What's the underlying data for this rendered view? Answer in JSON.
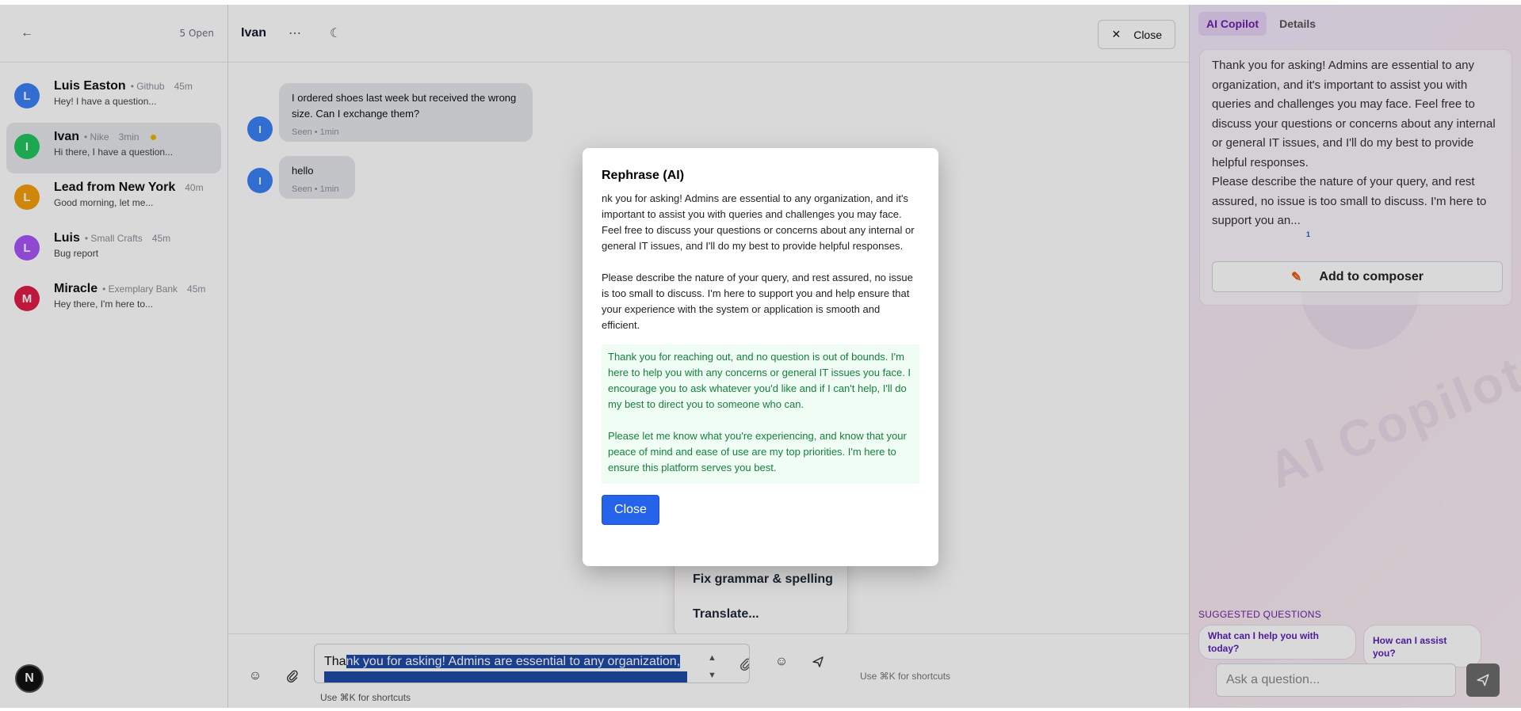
{
  "sidebar": {
    "open_count": "5 Open",
    "conversations": [
      {
        "initial": "L",
        "name": "Luis Easton",
        "org": "• Github",
        "time": "45m",
        "preview": "Hey! I have a question...",
        "color": "#3b82f6"
      },
      {
        "initial": "I",
        "name": "Ivan",
        "org": "• Nike",
        "time": "3min",
        "preview": "Hi there, I have a question...",
        "color": "#22c55e"
      },
      {
        "initial": "L",
        "name": "Lead from New York",
        "org": "",
        "time": "40m",
        "preview": "Good morning, let me...",
        "color": "#f59e0b"
      },
      {
        "initial": "L",
        "name": "Luis",
        "org": "• Small Crafts",
        "time": "45m",
        "preview": "Bug report",
        "color": "#a855f7"
      },
      {
        "initial": "M",
        "name": "Miracle",
        "org": "• Exemplary Bank",
        "time": "45m",
        "preview": "Hey there, I'm here to...",
        "color": "#e11d48"
      }
    ],
    "badge": "N"
  },
  "header": {
    "title": "Ivan",
    "close_label": "Close"
  },
  "messages": [
    {
      "initial": "I",
      "text": "I ordered shoes last week but received the wrong size. Can I exchange them?",
      "meta": "Seen • 1min"
    },
    {
      "initial": "I",
      "text": "hello",
      "meta": "Seen • 1min"
    }
  ],
  "menu": {
    "items": [
      "Fix grammar & spelling",
      "Translate..."
    ]
  },
  "composer": {
    "value_start": "Tha",
    "value_selected": "nk you for asking! Admins are essential to any organization,",
    "hint": "Use ⌘K for shortcuts",
    "hint_right": "Use ⌘K for shortcuts"
  },
  "copilot": {
    "tabs": [
      "AI Copilot",
      "Details"
    ],
    "para1": "Thank you for asking! Admins are essential to any organization, and it's important to assist you with queries and challenges you may face. Feel free to discuss your questions or concerns about any internal or general IT issues, and I'll do my best to provide helpful responses.",
    "para2": "Please describe the nature of your query, and rest assured, no issue is too small to discuss. I'm here to support you an...",
    "footnote": "1",
    "add_label": "Add to composer",
    "watermark": "AI Copilot",
    "suggested_label": "SUGGESTED QUESTIONS",
    "suggestions": [
      "What can I help you with today?",
      "How can I assist you?"
    ],
    "ask_placeholder": "Ask a question..."
  },
  "modal": {
    "title": "Rephrase (AI)",
    "original": "nk you for asking! Admins are essential to any organization, and it's important to assist you with queries and challenges you may face. Feel free to discuss your questions or concerns about any internal or general IT issues, and I'll do my best to provide helpful responses.\n\nPlease describe the nature of your query, and rest assured, no issue is too small to discuss. I'm here to support you and help ensure that your experience with the system or application is smooth and efficient.",
    "rephrased": "Thank you for reaching out, and no question is out of bounds. I'm here to help you with any concerns or general IT issues you face. I encourage you to ask whatever you'd like and if I can't help, I'll do my best to direct you to someone who can.\n\nPlease let me know what you're experiencing, and know that your peace of mind and ease of use are my top priorities. I'm here to ensure this platform serves you best.",
    "close_label": "Close"
  }
}
